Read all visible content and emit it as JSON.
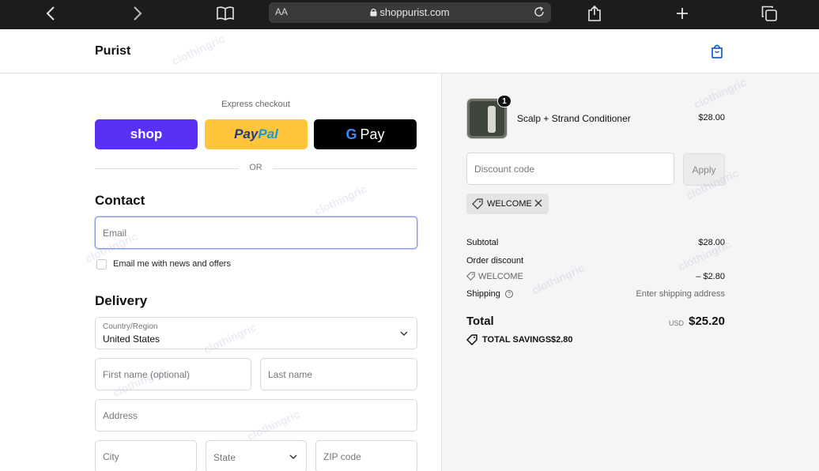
{
  "browser": {
    "aa_label": "AA",
    "url": "shoppurist.com"
  },
  "header": {
    "brand": "Purist"
  },
  "express": {
    "label": "Express checkout",
    "shop_label": "shop",
    "paypal_pay": "Pay",
    "paypal_pal": "Pal",
    "gpay_g": "G",
    "gpay_label": "Pay",
    "or_label": "OR"
  },
  "contact": {
    "heading": "Contact",
    "email_placeholder": "Email",
    "newsletter_label": "Email me with news and offers"
  },
  "delivery": {
    "heading": "Delivery",
    "country_label": "Country/Region",
    "country_value": "United States",
    "first_name_placeholder": "First name (optional)",
    "last_name_placeholder": "Last name",
    "address_placeholder": "Address",
    "city_placeholder": "City",
    "state_label": "State",
    "zip_placeholder": "ZIP code"
  },
  "cart": {
    "item": {
      "quantity": "1",
      "name": "Scalp + Strand Conditioner",
      "price": "$28.00"
    },
    "discount_placeholder": "Discount code",
    "apply_label": "Apply",
    "applied_code": "WELCOME"
  },
  "summary": {
    "subtotal_label": "Subtotal",
    "subtotal_value": "$28.00",
    "order_discount_label": "Order discount",
    "discount_code": "WELCOME",
    "discount_value": "– $2.80",
    "shipping_label": "Shipping",
    "shipping_value": "Enter shipping address",
    "total_label": "Total",
    "currency": "USD",
    "total_value": "$25.20",
    "savings_label": "TOTAL SAVINGS",
    "savings_value": "$2.80"
  },
  "watermark": "clothingric",
  "colors": {
    "shop_purple": "#5a31f4",
    "paypal_yellow": "#ffc439",
    "gpay_black": "#000000",
    "focus_border": "#8a9ae0",
    "accent_blue": "#1f5fbf"
  }
}
